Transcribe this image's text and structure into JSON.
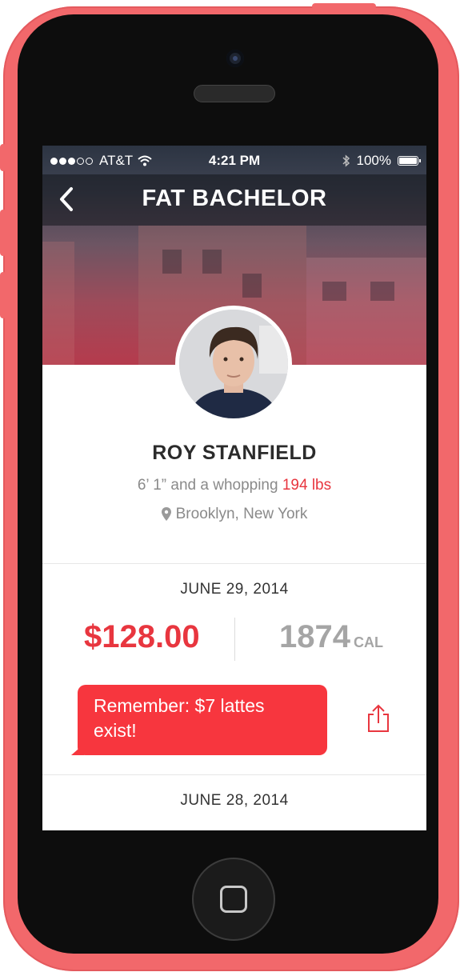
{
  "status_bar": {
    "carrier": "AT&T",
    "time": "4:21 PM",
    "battery": "100%",
    "signal_icon": "signal-dots-icon",
    "wifi_icon": "wifi-icon",
    "bluetooth_icon": "bluetooth-icon"
  },
  "nav": {
    "title": "FAT BACHELOR",
    "back_icon": "chevron-left-icon"
  },
  "profile": {
    "name": "ROY STANFIELD",
    "stats_prefix": "6’ 1” and a whopping ",
    "weight": "194 lbs",
    "location": "Brooklyn, New York",
    "location_icon": "map-pin-icon"
  },
  "entries": [
    {
      "date": "JUNE 29, 2014",
      "amount": "$128.00",
      "calories": "1874",
      "calories_unit": "CAL",
      "reminder": "Remember: $7 lattes exist!",
      "share_icon": "share-icon"
    },
    {
      "date": "JUNE 28, 2014"
    }
  ],
  "colors": {
    "accent": "#f7363e",
    "phone_shell": "#f2686b",
    "muted_text": "#8a8a8a"
  }
}
